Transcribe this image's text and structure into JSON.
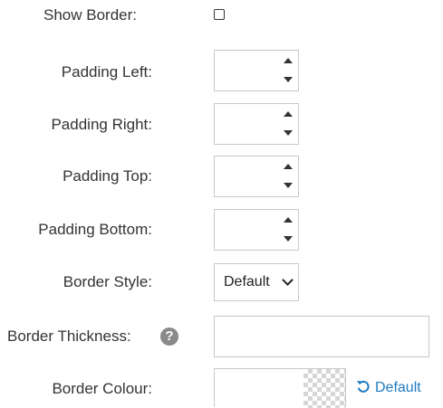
{
  "form": {
    "show_border": {
      "label": "Show Border:",
      "checked": false
    },
    "padding_left": {
      "label": "Padding Left:",
      "value": ""
    },
    "padding_right": {
      "label": "Padding Right:",
      "value": ""
    },
    "padding_top": {
      "label": "Padding Top:",
      "value": ""
    },
    "padding_bottom": {
      "label": "Padding Bottom:",
      "value": ""
    },
    "border_style": {
      "label": "Border Style:",
      "selected": "Default"
    },
    "border_thickness": {
      "label": "Border Thickness:",
      "value": "",
      "help_icon": "question-circle-icon",
      "help_glyph": "?"
    },
    "border_colour": {
      "label": "Border Colour:",
      "value": "",
      "reset_label": "Default",
      "reset_icon": "undo-icon"
    }
  },
  "colors": {
    "text": "#333333",
    "link": "#1e7bc2",
    "input_border": "#c8c8c8",
    "help_icon_bg": "#8a8a8a"
  }
}
